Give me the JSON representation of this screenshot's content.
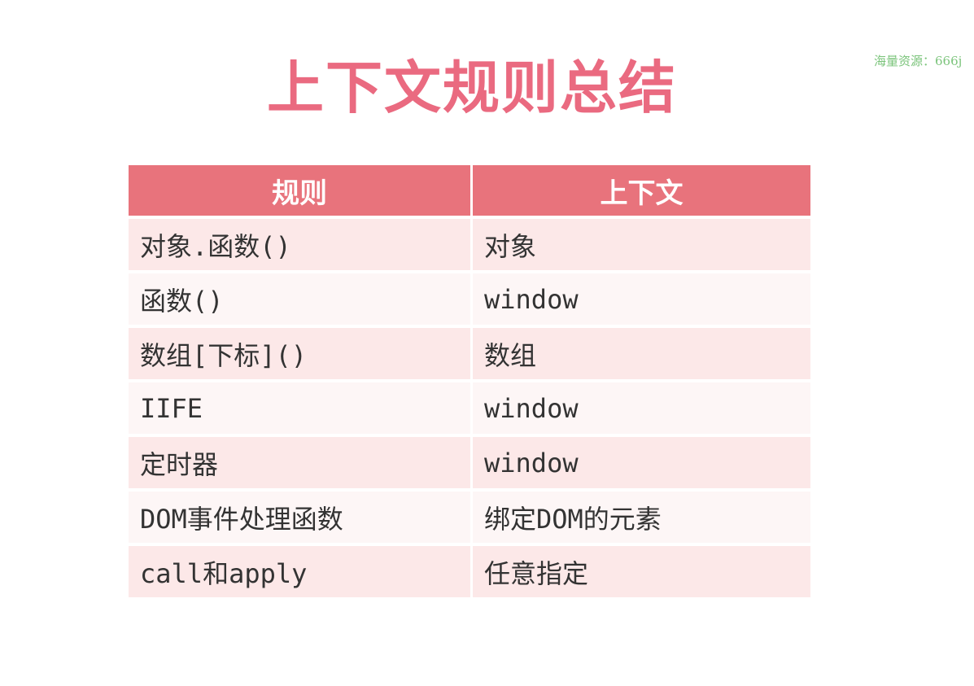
{
  "title": "上下文规则总结",
  "watermark": "海量资源：666j",
  "table": {
    "headers": [
      "规则",
      "上下文"
    ],
    "rows": [
      [
        "对象.函数()",
        "对象"
      ],
      [
        "函数()",
        "window"
      ],
      [
        "数组[下标]()",
        "数组"
      ],
      [
        "IIFE",
        "window"
      ],
      [
        "定时器",
        "window"
      ],
      [
        "DOM事件处理函数",
        "绑定DOM的元素"
      ],
      [
        "call和apply",
        "任意指定"
      ]
    ]
  },
  "colors": {
    "header": "#e8737c",
    "title": "#ea6a80",
    "row_odd": "#fce8e8"
  }
}
